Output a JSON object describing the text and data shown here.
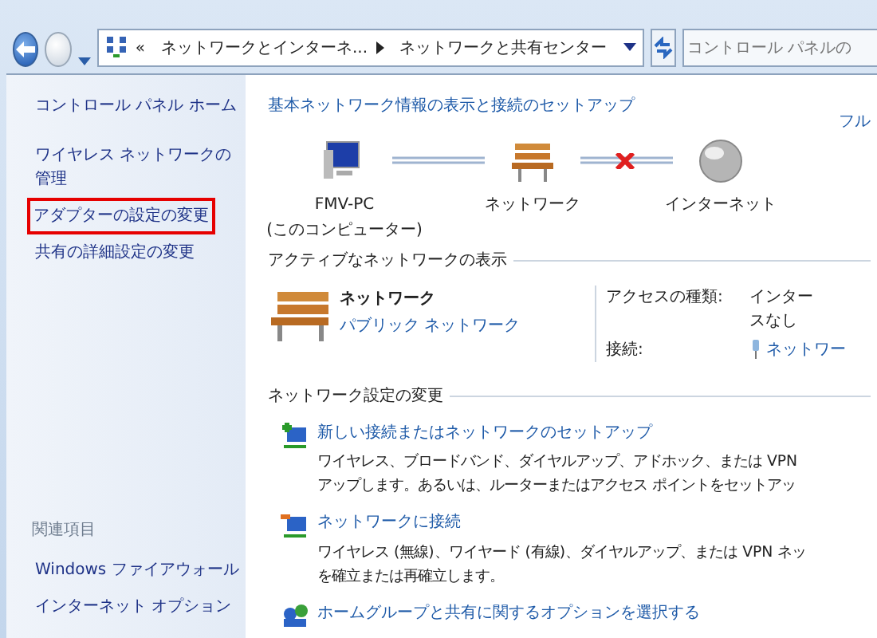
{
  "address_bar": {
    "overflow": "«",
    "crumbs": [
      "ネットワークとインターネ...",
      "ネットワークと共有センター"
    ]
  },
  "search": {
    "placeholder": "コントロール パネルの"
  },
  "sidebar": {
    "items": [
      {
        "label": "コントロール パネル ホーム",
        "highlighted": false
      },
      {
        "label": "ワイヤレス ネットワークの管理",
        "highlighted": false
      },
      {
        "label": "アダプターの設定の変更",
        "highlighted": true
      },
      {
        "label": "共有の詳細設定の変更",
        "highlighted": false
      }
    ],
    "related_heading": "関連項目",
    "related": [
      "Windows ファイアウォール",
      "インターネット オプション"
    ]
  },
  "main": {
    "heading": "基本ネットワーク情報の表示と接続のセットアップ",
    "map_link": "フル",
    "map_nodes": [
      {
        "kind": "computer",
        "lines": [
          "FMV-PC",
          "(このコンピューター)"
        ]
      },
      {
        "kind": "network",
        "lines": [
          "ネットワーク"
        ]
      },
      {
        "kind": "internet",
        "lines": [
          "インターネット"
        ]
      }
    ],
    "map_links": [
      {
        "connected": true
      },
      {
        "connected": false
      }
    ],
    "active_title": "アクティブなネットワークの表示",
    "network_name": "ネットワーク",
    "network_type": "パブリック ネットワーク",
    "access_label": "アクセスの種類:",
    "access_value": [
      "インター",
      "スなし"
    ],
    "connection_label": "接続:",
    "connection_value": "ネットワー",
    "changes_title": "ネットワーク設定の変更",
    "tasks": [
      {
        "kind": "new",
        "title": "新しい接続またはネットワークのセットアップ",
        "description": [
          "ワイヤレス、ブロードバンド、ダイヤルアップ、アドホック、または VPN",
          "アップします。あるいは、ルーターまたはアクセス ポイントをセットアッ"
        ]
      },
      {
        "kind": "connect",
        "title": "ネットワークに接続",
        "description": [
          "ワイヤレス (無線)、ワイヤード (有線)、ダイヤルアップ、または VPN ネッ",
          "を確立または再確立します。"
        ]
      },
      {
        "kind": "homegroup",
        "title": "ホームグループと共有に関するオプションを選択する"
      }
    ]
  }
}
